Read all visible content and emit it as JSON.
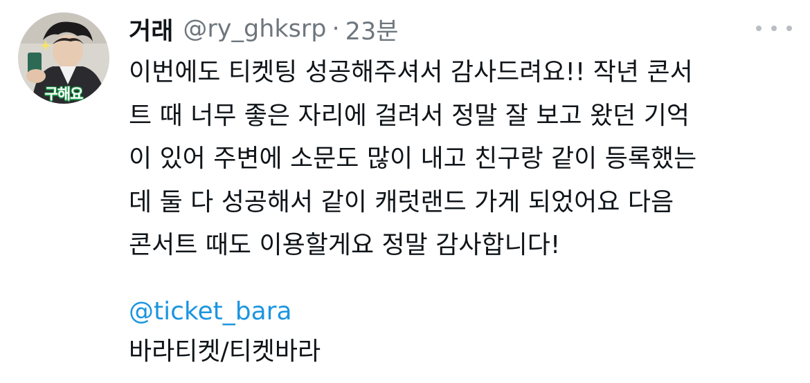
{
  "tweet": {
    "author": {
      "display_name": "거래",
      "handle": "@ry_ghksrp",
      "avatar_caption": "구해요"
    },
    "separator": "·",
    "timestamp": "23분",
    "more_icon": "more-horizontal-icon",
    "body_lines": [
      "이번에도 티켓팅 성공해주셔서 감사드려요!! 작년 콘서",
      "트 때 너무 좋은 자리에 걸려서 정말 잘 보고 왔던 기억",
      "이 있어 주변에 소문도 많이 내고 친구랑 같이 등록했는",
      "데 둘 다 성공해서 같이 캐럿랜드 가게 되었어요 다음",
      "콘서트 때도 이용할게요 정말 감사합니다!"
    ],
    "mention": "@ticket_bara",
    "signature": "바라티켓/티켓바라"
  },
  "colors": {
    "text": "#0f1419",
    "secondary_text": "#6e767d",
    "link": "#1b95e0",
    "avatar_caption_outline": "#1e9a4a"
  }
}
